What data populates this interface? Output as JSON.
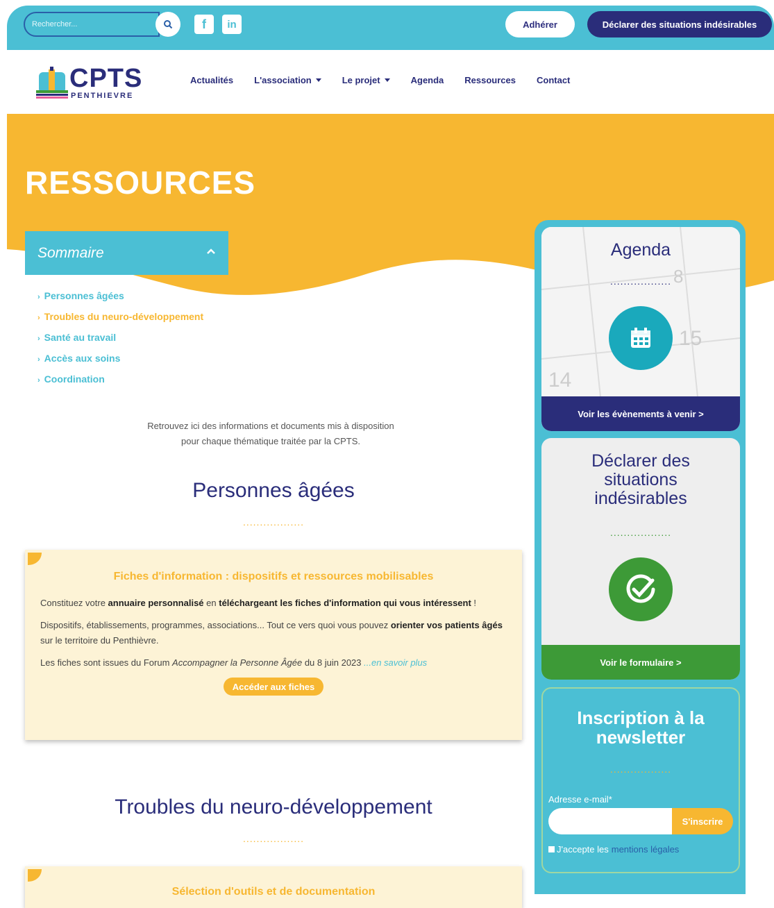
{
  "topbar": {
    "search_placeholder": "Rechercher...",
    "adherer_label": "Adhérer",
    "declare_label": "Déclarer des situations indésirables"
  },
  "logo": {
    "title": "CPTS",
    "subtitle": "PENTHIEVRE"
  },
  "nav": {
    "items": [
      "Actualités",
      "L'association",
      "Le projet",
      "Agenda",
      "Ressources",
      "Contact"
    ]
  },
  "page": {
    "title": "RESSOURCES"
  },
  "sommaire": {
    "title": "Sommaire",
    "items": [
      "Personnes âgées",
      "Troubles du neuro-développement",
      "Santé au travail",
      "Accès aux soins",
      "Coordination"
    ]
  },
  "intro": {
    "line1": "Retrouvez ici des informations et documents mis à disposition",
    "line2": "pour chaque thématique traitée par la CPTS."
  },
  "sections": {
    "personnes": {
      "title": "Personnes âgées",
      "dots": "..................",
      "card_title": "Fiches d'information : dispositifs et ressources mobilisables",
      "p1_a": "Constituez votre ",
      "p1_b": "annuaire personnalisé",
      "p1_c": " en ",
      "p1_d": "téléchargeant les fiches d'information qui vous intéressent",
      "p1_e": " !",
      "p2_a": "Dispositifs, établissements, programmes, associations... Tout ce vers quoi vous pouvez ",
      "p2_b": "orienter vos patients âgés",
      "p2_c": " sur le territoire du Penthièvre.",
      "p3_a": "Les fiches sont issues du Forum ",
      "p3_b": "Accompagner la Personne Âgée",
      "p3_c": " du 8 juin 2023 ",
      "p3_link": "...en savoir plus",
      "button": "Accéder aux fiches"
    },
    "troubles": {
      "title": "Troubles du neuro-développement",
      "dots": "..................",
      "card_title": "Sélection d'outils et de documentation"
    }
  },
  "sidebar": {
    "agenda": {
      "title": "Agenda",
      "dots": "..................",
      "link": "Voir les évènements à venir >"
    },
    "declare": {
      "title_l1": "Déclarer des",
      "title_l2": "situations",
      "title_l3": "indésirables",
      "dots": "..................",
      "link": "Voir le formulaire >"
    },
    "newsletter": {
      "title_l1": "Inscription à la",
      "title_l2": "newsletter",
      "dots": "..................",
      "email_label": "Adresse e-mail*",
      "submit": "S'inscrire",
      "accept": "J'accepte les",
      "legal": "mentions légales"
    }
  },
  "colors": {
    "cyan": "#4bbfd4",
    "navy": "#2a2d7a",
    "yellow": "#f7b731",
    "green": "#3d9a37"
  }
}
